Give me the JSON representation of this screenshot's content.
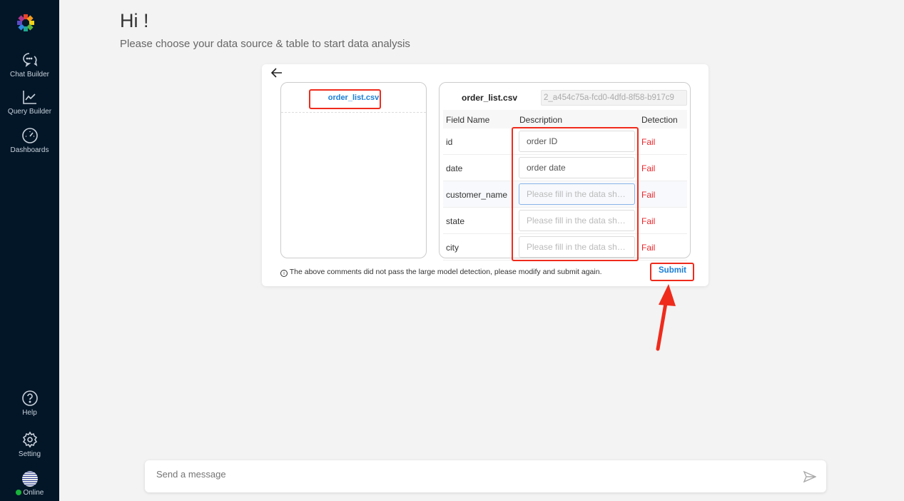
{
  "sidebar": {
    "items": [
      {
        "label": "Chat Builder",
        "icon": "chat-icon"
      },
      {
        "label": "Query Builder",
        "icon": "line-chart-icon"
      },
      {
        "label": "Dashboards",
        "icon": "dashboard-gauge-icon"
      },
      {
        "label": "Help",
        "icon": "help-icon"
      },
      {
        "label": "Setting",
        "icon": "gear-icon"
      }
    ],
    "status": "Online",
    "status_color": "#18b33a"
  },
  "header": {
    "title": "Hi !",
    "subtitle": "Please choose your data source & table to start data analysis"
  },
  "files": {
    "selected": "order_list.csv"
  },
  "detail": {
    "file_name": "order_list.csv",
    "table_id": "2_a454c75a-fcd0-4dfd-8f58-b917c9",
    "columns": [
      "Field Name",
      "Description",
      "Detection"
    ],
    "rows": [
      {
        "field": "id",
        "description": "order ID",
        "placeholder": "",
        "detection": "Fail"
      },
      {
        "field": "date",
        "description": "order date",
        "placeholder": "",
        "detection": "Fail"
      },
      {
        "field": "customer_name",
        "description": "",
        "placeholder": "Please fill in the data sheet",
        "detection": "Fail"
      },
      {
        "field": "state",
        "description": "",
        "placeholder": "Please fill in the data she...",
        "detection": "Fail"
      },
      {
        "field": "city",
        "description": "",
        "placeholder": "Please fill in the data she...",
        "detection": "Fail"
      }
    ]
  },
  "notice": "The above comments did not pass the large model detection, please modify and submit again.",
  "submit_label": "Submit",
  "chat": {
    "placeholder": "Send a message"
  },
  "colors": {
    "accent": "#1a7fd6",
    "fail": "#e8262b",
    "annotation": "#ef2b1c",
    "sidebar": "#021628"
  }
}
